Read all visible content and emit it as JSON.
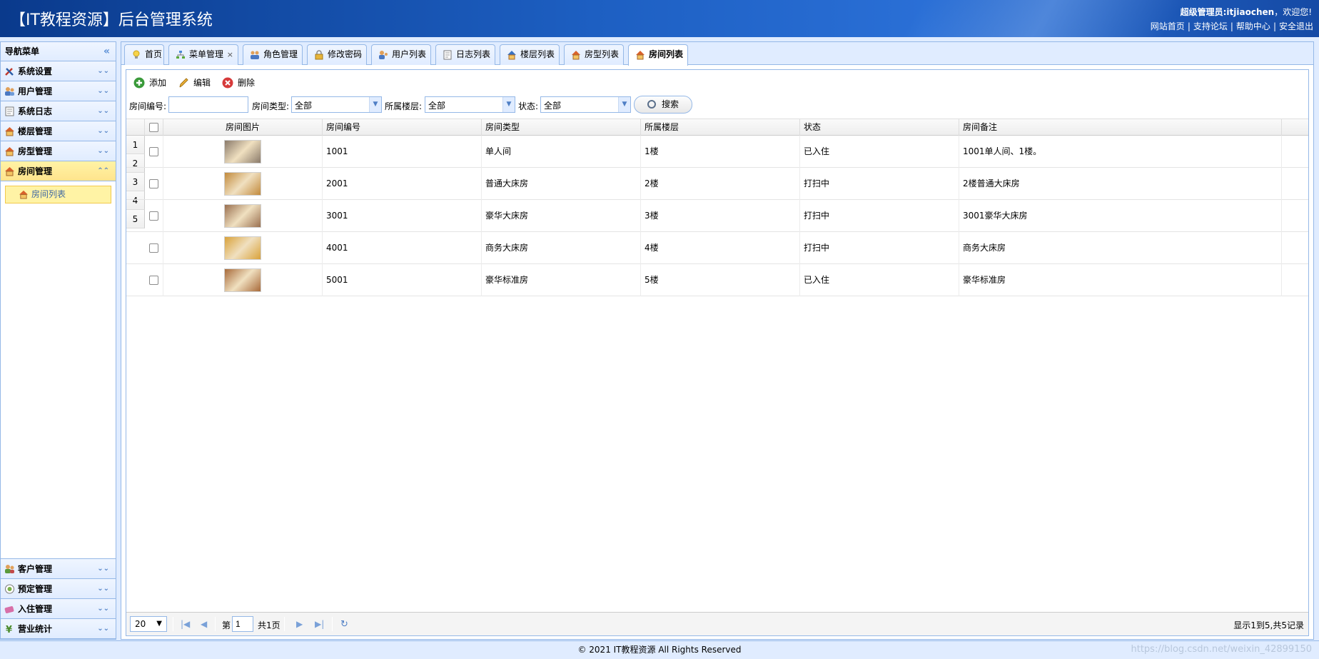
{
  "header": {
    "title": "【IT教程资源】后台管理系统",
    "welcome_user": "超级管理员:itjiaochen",
    "welcome_suffix": "，欢迎您!",
    "links": [
      "网站首页",
      "支持论坛",
      "帮助中心",
      "安全退出"
    ]
  },
  "sidebar": {
    "title": "导航菜单",
    "menus": [
      {
        "label": "系统设置",
        "icon": "tools-icon"
      },
      {
        "label": "用户管理",
        "icon": "users-icon"
      },
      {
        "label": "系统日志",
        "icon": "log-icon"
      },
      {
        "label": "楼层管理",
        "icon": "house-icon"
      },
      {
        "label": "房型管理",
        "icon": "house-icon"
      },
      {
        "label": "房间管理",
        "icon": "house-icon",
        "active": true
      }
    ],
    "active_submenu": "房间列表",
    "bottom_menus": [
      {
        "label": "客户管理",
        "icon": "customer-icon"
      },
      {
        "label": "预定管理",
        "icon": "reserve-icon"
      },
      {
        "label": "入住管理",
        "icon": "checkin-icon"
      },
      {
        "label": "营业统计",
        "icon": "money-icon"
      }
    ]
  },
  "tabs": [
    {
      "label": "首页",
      "closable": false,
      "icon": "lightbulb-icon"
    },
    {
      "label": "菜单管理",
      "closable": true,
      "icon": "tree-icon"
    },
    {
      "label": "角色管理",
      "closable": true,
      "icon": "group-icon"
    },
    {
      "label": "修改密码",
      "closable": true,
      "icon": "lock-icon"
    },
    {
      "label": "用户列表",
      "closable": true,
      "icon": "user-icon"
    },
    {
      "label": "日志列表",
      "closable": true,
      "icon": "document-icon"
    },
    {
      "label": "楼层列表",
      "closable": true,
      "icon": "house-icon"
    },
    {
      "label": "房型列表",
      "closable": true,
      "icon": "house-icon"
    },
    {
      "label": "房间列表",
      "closable": true,
      "icon": "house-icon",
      "active": true
    }
  ],
  "toolbar": {
    "add": "添加",
    "edit": "编辑",
    "delete": "删除"
  },
  "search": {
    "room_no_label": "房间编号:",
    "room_no_value": "",
    "room_type_label": "房间类型:",
    "room_type_value": "全部",
    "floor_label": "所属楼层:",
    "floor_value": "全部",
    "status_label": "状态:",
    "status_value": "全部",
    "search_button": "搜索"
  },
  "grid": {
    "columns": [
      "房间图片",
      "房间编号",
      "房间类型",
      "所属楼层",
      "状态",
      "房间备注"
    ],
    "rows": [
      {
        "num": "1",
        "no": "1001",
        "type": "单人间",
        "floor": "1楼",
        "status": "已入住",
        "remark": "1001单人间、1楼。",
        "img_color": "#8a7a6a"
      },
      {
        "num": "2",
        "no": "2001",
        "type": "普通大床房",
        "floor": "2楼",
        "status": "打扫中",
        "remark": "2楼普通大床房",
        "img_color": "#c28a3c"
      },
      {
        "num": "3",
        "no": "3001",
        "type": "豪华大床房",
        "floor": "3楼",
        "status": "打扫中",
        "remark": "3001豪华大床房",
        "img_color": "#9a7050"
      },
      {
        "num": "4",
        "no": "4001",
        "type": "商务大床房",
        "floor": "4楼",
        "status": "打扫中",
        "remark": "商务大床房",
        "img_color": "#d9a23a"
      },
      {
        "num": "5",
        "no": "5001",
        "type": "豪华标准房",
        "floor": "5楼",
        "status": "已入住",
        "remark": "豪华标准房",
        "img_color": "#a86a3a"
      }
    ]
  },
  "pager": {
    "page_size": "20",
    "page_prefix": "第",
    "page_value": "1",
    "page_total": "共1页",
    "summary": "显示1到5,共5记录"
  },
  "footer": {
    "copyright": "© 2021 IT教程资源 All Rights Reserved",
    "watermark": "https://blog.csdn.net/weixin_42899150"
  }
}
